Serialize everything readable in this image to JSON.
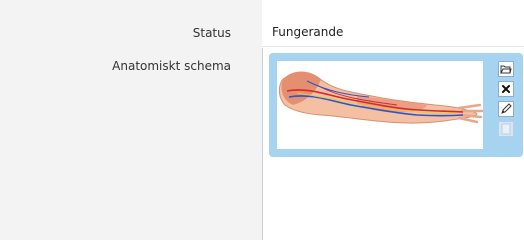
{
  "fields": {
    "status_label": "Status",
    "status_value": "Fungerande",
    "schema_label": "Anatomiskt schema"
  },
  "image": {
    "description_icon": "anatomical-arm-illustration"
  },
  "toolbar": {
    "buttons": [
      {
        "icon": "open-folder-icon",
        "enabled": true
      },
      {
        "icon": "delete-icon",
        "enabled": true
      },
      {
        "icon": "edit-pencil-icon",
        "enabled": true
      },
      {
        "icon": "blank-icon",
        "enabled": false
      }
    ]
  },
  "colors": {
    "frame": "#a6d3ef",
    "left_panel": "#f3f3f3"
  }
}
